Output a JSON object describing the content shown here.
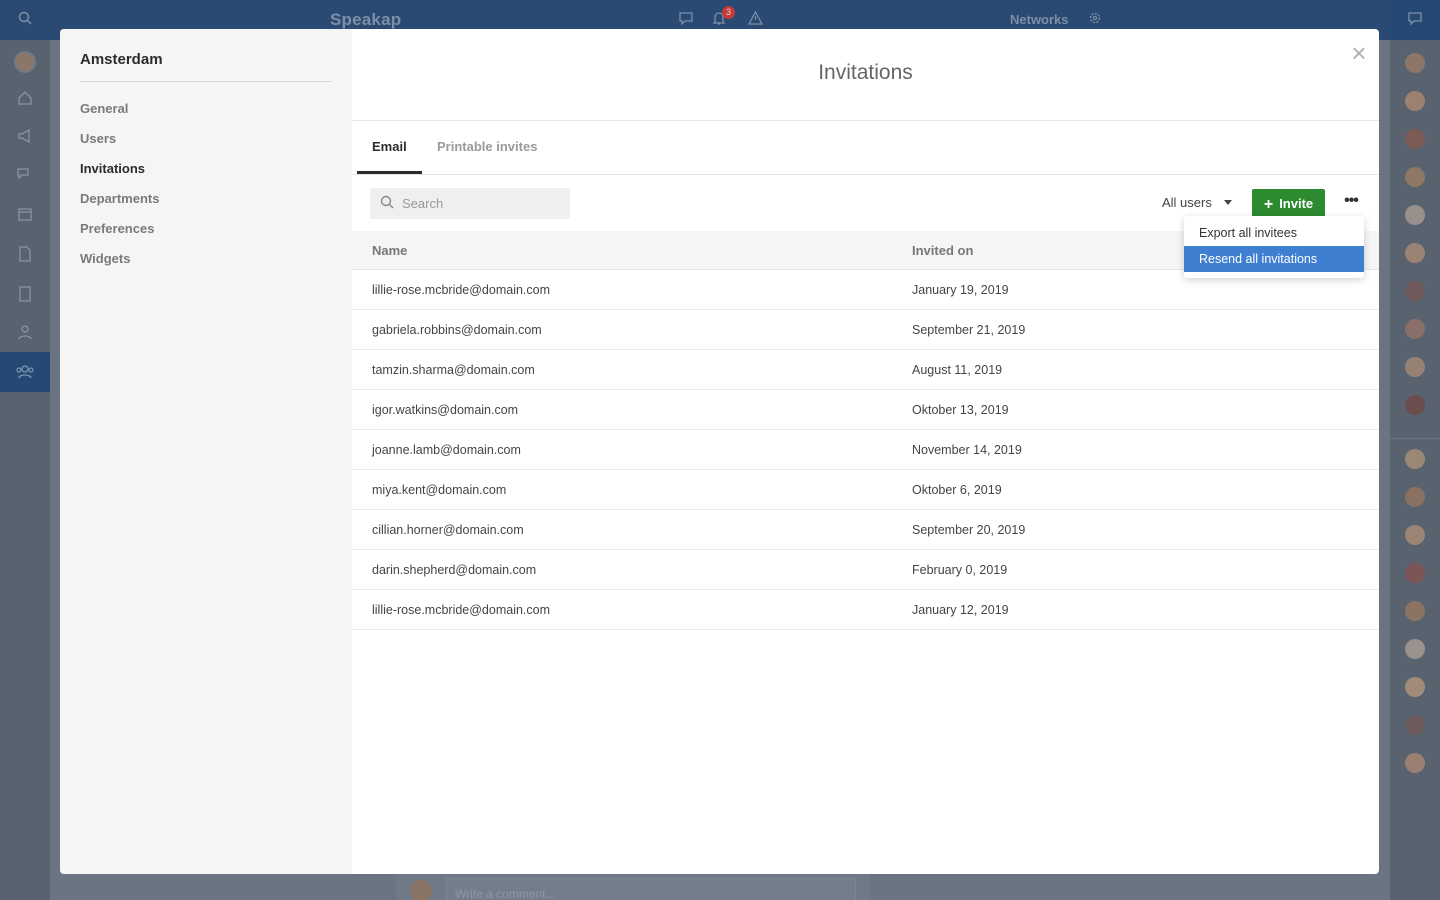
{
  "app": {
    "brand": "Speakap",
    "notification_count": "3",
    "networks_label": "Networks",
    "comment_placeholder": "Write a comment..."
  },
  "modal": {
    "sidebar": {
      "org_name": "Amsterdam",
      "items": [
        {
          "label": "General",
          "active": false
        },
        {
          "label": "Users",
          "active": false
        },
        {
          "label": "Invitations",
          "active": true
        },
        {
          "label": "Departments",
          "active": false
        },
        {
          "label": "Preferences",
          "active": false
        },
        {
          "label": "Widgets",
          "active": false
        }
      ]
    },
    "title": "Invitations",
    "close_label": "×",
    "tabs": [
      {
        "label": "Email",
        "active": true
      },
      {
        "label": "Printable invites",
        "active": false
      }
    ],
    "toolbar": {
      "search_placeholder": "Search",
      "filter_label": "All users",
      "invite_label": "Invite",
      "invite_icon": "+",
      "more_label": "•••"
    },
    "table": {
      "columns": [
        "Name",
        "Invited on"
      ],
      "rows": [
        {
          "name": "lillie-rose.mcbride@domain.com",
          "invited_on": "January 19, 2019"
        },
        {
          "name": "gabriela.robbins@domain.com",
          "invited_on": "September 21, 2019"
        },
        {
          "name": "tamzin.sharma@domain.com",
          "invited_on": "August 11, 2019"
        },
        {
          "name": "igor.watkins@domain.com",
          "invited_on": "Oktober 13, 2019"
        },
        {
          "name": "joanne.lamb@domain.com",
          "invited_on": "November 14, 2019"
        },
        {
          "name": "miya.kent@domain.com",
          "invited_on": "Oktober 6, 2019"
        },
        {
          "name": "cillian.horner@domain.com",
          "invited_on": "September 20, 2019"
        },
        {
          "name": "darin.shepherd@domain.com",
          "invited_on": "February 0, 2019"
        },
        {
          "name": "lillie-rose.mcbride@domain.com",
          "invited_on": "January 12, 2019"
        }
      ]
    },
    "dropdown": {
      "options": [
        {
          "label": "Export all invitees",
          "highlighted": false
        },
        {
          "label": "Resend all invitations",
          "highlighted": true
        }
      ]
    }
  },
  "colors": {
    "invite_button": "#2c8a2f",
    "dropdown_highlight": "#3f7fd1",
    "topbar": "#2a4a73",
    "overlay": "#6b7581"
  }
}
